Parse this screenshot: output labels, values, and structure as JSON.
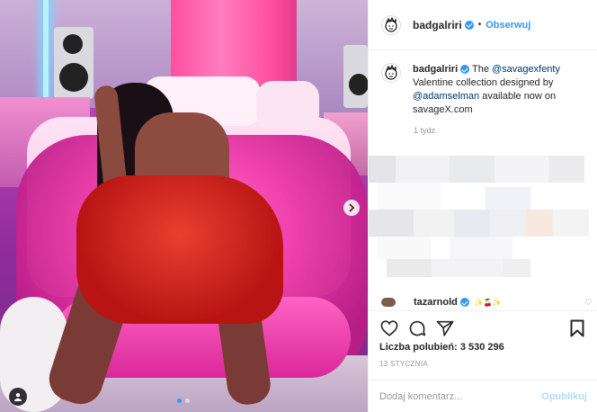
{
  "post": {
    "username": "badgalriri",
    "follow_label": "Obserwuj",
    "separator": "•"
  },
  "caption": {
    "username": "badgalriri",
    "text_before": " The ",
    "mention1": "@savagexfenty",
    "text_middle": " Valentine collection designed by ",
    "mention2": "@adamselman",
    "text_after": " available now on savageX.com",
    "time": "1 tydz."
  },
  "comment_preview": {
    "name": "tazarnold",
    "emoji": "✨🍒✨"
  },
  "stats": {
    "likes": "Liczba polubień: 3 530 296",
    "date": "13 STYCZNIA"
  },
  "comment_input": {
    "placeholder": "Dodaj komentarz...",
    "publish_label": "Opublikuj"
  },
  "carousel": {
    "total": 2,
    "current": 1
  },
  "icons": {
    "verified": "verified-badge-icon",
    "like": "heart-icon",
    "comment": "comment-bubble-icon",
    "share": "paper-plane-icon",
    "save": "bookmark-icon",
    "next": "chevron-right-icon",
    "user_tag": "user-tag-icon"
  },
  "colors": {
    "accent": "#3897f0",
    "publish_disabled": "#b3dbff",
    "secondary_text": "#999999",
    "link_text": "#003569",
    "border": "#efefef"
  }
}
